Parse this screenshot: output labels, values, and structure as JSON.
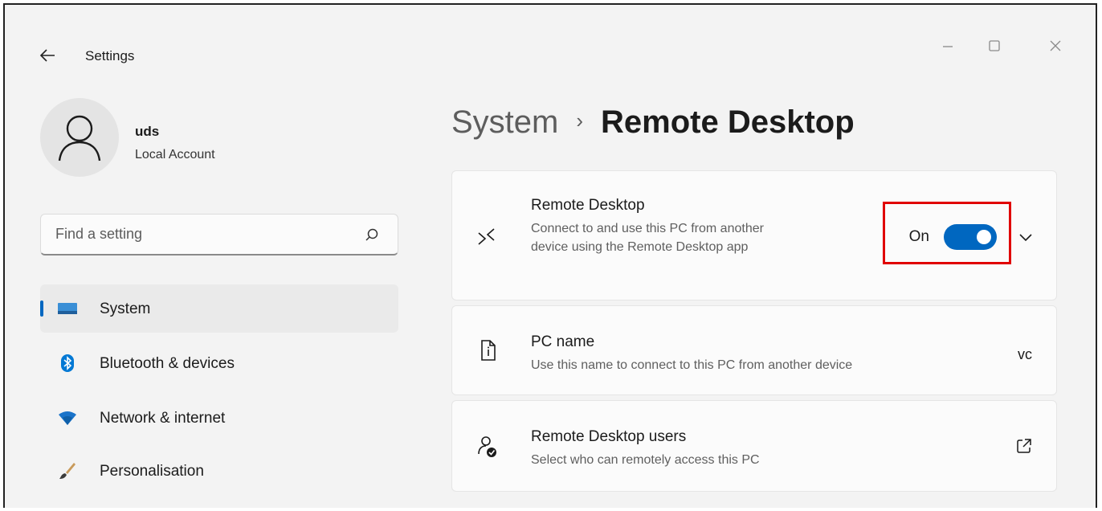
{
  "window": {
    "title": "Settings"
  },
  "profile": {
    "name": "uds",
    "account_type": "Local Account"
  },
  "search": {
    "placeholder": "Find a setting"
  },
  "nav": {
    "items": [
      {
        "label": "System",
        "icon": "system-icon",
        "active": true
      },
      {
        "label": "Bluetooth & devices",
        "icon": "bluetooth-icon"
      },
      {
        "label": "Network & internet",
        "icon": "wifi-icon"
      },
      {
        "label": "Personalisation",
        "icon": "brush-icon"
      }
    ]
  },
  "header": {
    "parent": "System",
    "separator": "›",
    "current": "Remote Desktop"
  },
  "cards": {
    "remote_desktop": {
      "title": "Remote Desktop",
      "description": "Connect to and use this PC from another device using the Remote Desktop app",
      "state_label": "On",
      "enabled": true
    },
    "pc_name": {
      "title": "PC name",
      "description": "Use this name to connect to this PC from another device",
      "value": "vc"
    },
    "users": {
      "title": "Remote Desktop users",
      "description": "Select who can remotely access this PC"
    }
  },
  "colors": {
    "accent": "#0067c0",
    "highlight": "#e00000",
    "background": "#f3f3f3"
  }
}
